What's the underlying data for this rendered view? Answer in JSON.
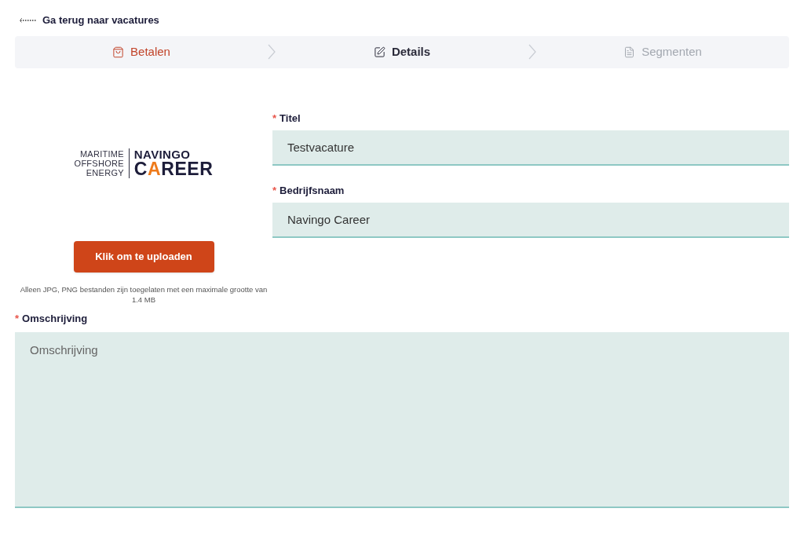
{
  "back_link": {
    "label": "Ga terug naar vacatures"
  },
  "steps": [
    {
      "label": "Betalen",
      "selected": false,
      "completed": true
    },
    {
      "label": "Details",
      "selected": true,
      "completed": false
    },
    {
      "label": "Segmenten",
      "selected": false,
      "completed": false
    }
  ],
  "logo": {
    "left_lines": [
      "MARITIME",
      "OFFSHORE",
      "ENERGY"
    ],
    "top": "NAVINGO",
    "bottom": "CAREER"
  },
  "upload_button": "Klik om te uploaden",
  "upload_hint": "Alleen JPG, PNG bestanden zijn toegelaten met een maximale grootte van 1.4 MB",
  "fields": [
    {
      "label": "Titel",
      "required": "*",
      "value": "Testvacature"
    },
    {
      "label": "Bedrijfsnaam",
      "required": "*",
      "value": "Navingo Career"
    }
  ],
  "description": {
    "label": "Omschrijving",
    "required": "*",
    "placeholder": "Omschrijving"
  }
}
